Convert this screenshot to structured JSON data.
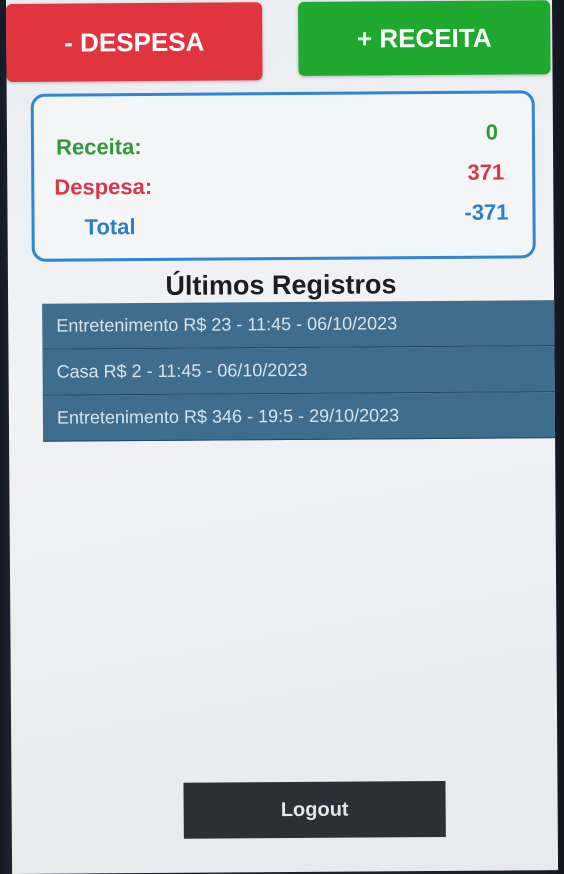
{
  "actions": {
    "despesa_label": "- DESPESA",
    "receita_label": "+ RECEITA"
  },
  "summary": {
    "receita_label": "Receita:",
    "receita_value": "0",
    "despesa_label": "Despesa:",
    "despesa_value": "371",
    "total_label": "Total",
    "total_value": "-371"
  },
  "records_section": {
    "title": "Últimos Registros",
    "items": [
      "Entretenimento R$ 23 - 11:45 - 06/10/2023",
      "Casa R$ 2 - 11:45 - 06/10/2023",
      "Entretenimento R$ 346 - 19:5 - 29/10/2023"
    ]
  },
  "footer": {
    "logout_label": "Logout"
  },
  "colors": {
    "despesa": "#e0343f",
    "receita": "#1faa2f",
    "total": "#2b7fc9",
    "record_row": "#3f6d8e",
    "logout": "#2b2f36"
  }
}
